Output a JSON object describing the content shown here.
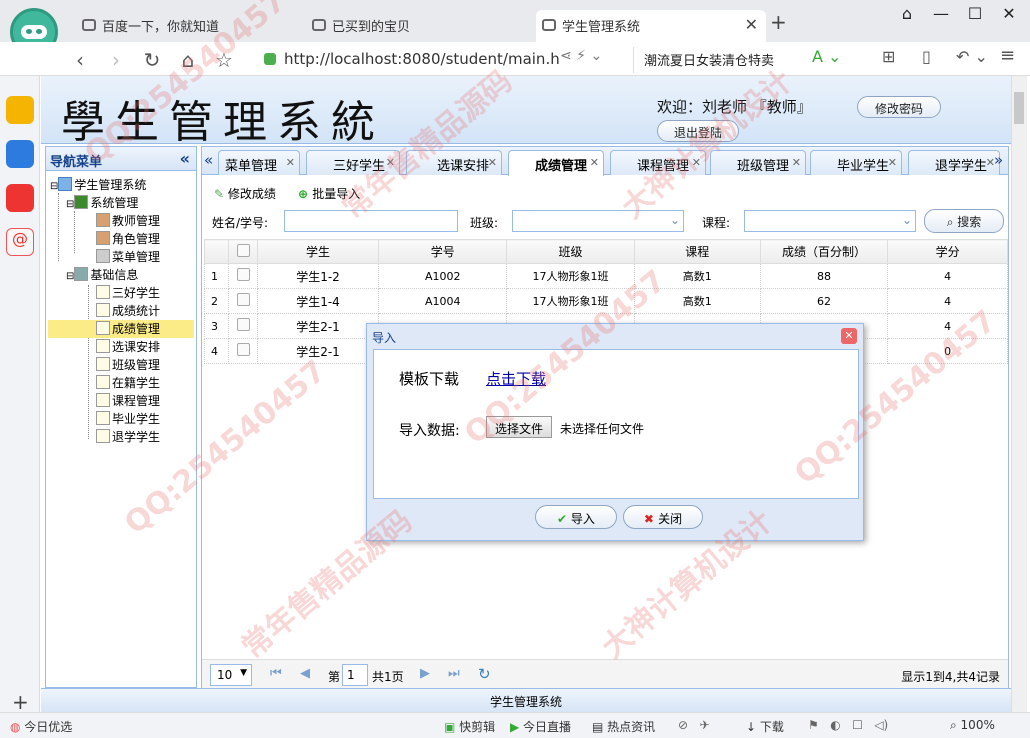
{
  "browser": {
    "tabs": [
      {
        "title": "百度一下，你就知道"
      },
      {
        "title": "已买到的宝贝"
      },
      {
        "title": "学生管理系统"
      }
    ],
    "new_tab": "+",
    "url": "http://localhost:8080/student/main.h",
    "search_text": "潮流夏日女装清仓特卖"
  },
  "header": {
    "system_name": "學生管理系統",
    "welcome": "欢迎：刘老师 『教师』",
    "change_password": "修改密码",
    "logout": "退出登陆"
  },
  "nav": {
    "title": "导航菜单",
    "collapse": "«",
    "root": "学生管理系统",
    "groups": [
      {
        "label": "系统管理",
        "items": [
          "教师管理",
          "角色管理",
          "菜单管理"
        ]
      },
      {
        "label": "基础信息",
        "items": [
          "三好学生",
          "成绩统计",
          "成绩管理",
          "选课安排",
          "班级管理",
          "在籍学生",
          "课程管理",
          "毕业学生",
          "退学学生"
        ]
      }
    ],
    "selected": "成绩管理"
  },
  "tabs": [
    "菜单管理",
    "三好学生",
    "选课安排",
    "成绩管理",
    "课程管理",
    "班级管理",
    "毕业学生",
    "退学学生"
  ],
  "active_tab": "成绩管理",
  "toolbar": {
    "edit": "修改成绩",
    "import": "批量导入"
  },
  "filters": {
    "name_label": "姓名/学号:",
    "class_label": "班级:",
    "course_label": "课程:",
    "search": "搜索"
  },
  "grid": {
    "columns": [
      "学生",
      "学号",
      "班级",
      "课程",
      "成绩（百分制）",
      "学分"
    ],
    "rows": [
      {
        "num": "1",
        "student": "学生1-2",
        "id": "A1002",
        "class": "17人物形象1班",
        "course": "高数1",
        "score": "88",
        "credit": "4"
      },
      {
        "num": "2",
        "student": "学生1-4",
        "id": "A1004",
        "class": "17人物形象1班",
        "course": "高数1",
        "score": "62",
        "credit": "4"
      },
      {
        "num": "3",
        "student": "学生2-1",
        "id": "",
        "class": "",
        "course": "",
        "score": "",
        "credit": "4"
      },
      {
        "num": "4",
        "student": "学生2-1",
        "id": "",
        "class": "",
        "course": "",
        "score": "",
        "credit": "0"
      }
    ]
  },
  "pager": {
    "page_size": "10",
    "page_prefix": "第",
    "page": "1",
    "page_total": "共1页",
    "summary": "显示1到4,共4记录"
  },
  "footer": "学生管理系统",
  "dialog": {
    "title": "导入",
    "template_label": "模板下载",
    "template_link": "点击下载",
    "data_label": "导入数据:",
    "choose_file": "选择文件",
    "no_file": "未选择任何文件",
    "ok": "导入",
    "close": "关闭"
  },
  "statusbar": {
    "left": "今日优选",
    "items": [
      "快剪辑",
      "今日直播",
      "热点资讯",
      "下载"
    ],
    "zoom": "100%"
  },
  "watermarks": [
    "QQ:254540457",
    "常年售精品源码",
    "大神计算机设计"
  ]
}
